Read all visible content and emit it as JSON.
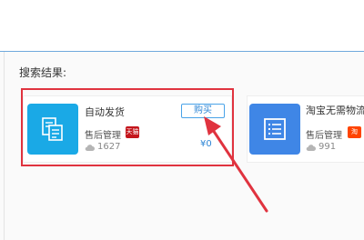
{
  "search": {
    "results_label": "搜索结果:"
  },
  "results": [
    {
      "name": "自动发货",
      "category": "售后管理",
      "badge_text": "天猫",
      "downloads": "1627",
      "price": "¥0",
      "buy_label": "购买",
      "icon": "document-list-icon",
      "icon_color": "#1aa9e6"
    },
    {
      "name": "淘宝无需物流",
      "category": "售后管理",
      "badge_text": "淘",
      "downloads": "991",
      "icon": "list-icon",
      "icon_color": "#3f86e6"
    }
  ],
  "annotation": {
    "box_color": "#e0333f"
  }
}
